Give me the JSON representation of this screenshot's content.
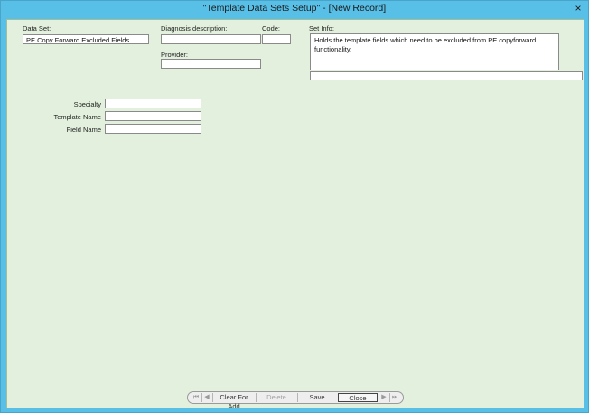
{
  "window": {
    "title": "\"Template Data Sets Setup\" - [New Record]",
    "close_glyph": "×"
  },
  "form": {
    "data_set_label": "Data Set:",
    "data_set_value": "PE Copy Forward Excluded Fields",
    "diagnosis_label": "Diagnosis description:",
    "diagnosis_value": "",
    "code_label": "Code:",
    "code_value": "",
    "provider_label": "Provider:",
    "provider_value": "",
    "set_info_label": "Set Info:",
    "set_info_value": "Holds the template fields which need to be excluded from PE copyforward functionality.",
    "set_info_extra_value": "",
    "specialty_label": "Specialty",
    "specialty_value": "",
    "template_name_label": "Template Name",
    "template_name_value": "",
    "field_name_label": "Field Name",
    "field_name_value": ""
  },
  "navigator": {
    "first_icon": "first-record-icon",
    "prev_icon": "previous-record-icon",
    "next_icon": "next-record-icon",
    "last_icon": "last-record-icon",
    "first_glyph": "⏮",
    "prev_glyph": "◀",
    "next_glyph": "▶",
    "last_glyph": "⏭",
    "clear_for_add": "Clear For Add",
    "delete": "Delete",
    "save": "Save",
    "close": "Close"
  },
  "colors": {
    "titlebar": "#58bfe7",
    "client_background": "#e2f0dd"
  }
}
